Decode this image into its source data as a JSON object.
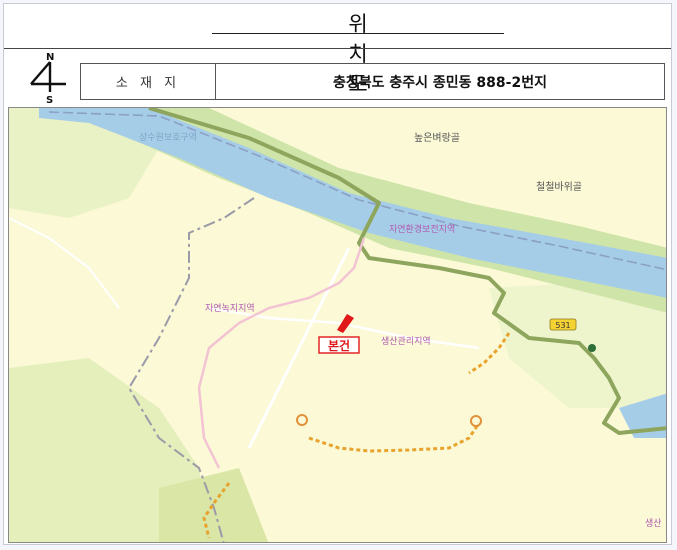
{
  "header": {
    "title": "위  치  도"
  },
  "north_arrow": {
    "n_label": "N",
    "s_label": "S"
  },
  "info": {
    "label": "소 재 지",
    "address": "충청북도 충주시 종민동 888-2번지"
  },
  "map": {
    "labels": {
      "river_zone_top": "상수원보호구역",
      "village_1": "높은벼랑골",
      "village_2": "철철바위골",
      "nature_zone": "자연환경보전지역",
      "farm_zone": "자연녹지지역",
      "production_zone": "생산관리지역",
      "route_number": "531",
      "site_marker": "본건",
      "edge_label": "생산"
    },
    "colors": {
      "land": "#fbf9d6",
      "river": "#a6cde8",
      "river_bank": "#bfe0a8",
      "forest": "#e3efb7",
      "highway": "#8da55c",
      "site_red": "#e11818"
    }
  }
}
